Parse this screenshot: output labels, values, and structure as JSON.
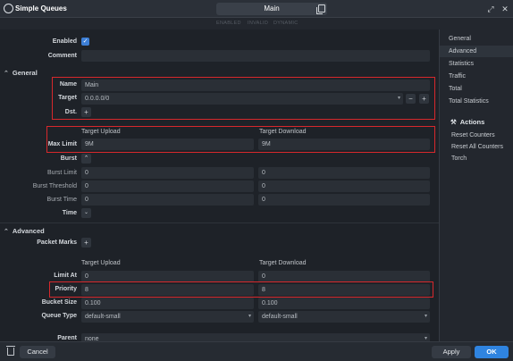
{
  "window": {
    "title": "Simple Queues",
    "name_value": "Main",
    "states": [
      "ENABLED",
      "INVALID",
      "DYNAMIC"
    ]
  },
  "form": {
    "enabled_label": "Enabled",
    "comment_label": "Comment",
    "comment_value": "",
    "general": {
      "section_label": "General",
      "name_label": "Name",
      "name_value": "Main",
      "target_label": "Target",
      "target_value": "0.0.0.0/0",
      "dst_label": "Dst.",
      "col_upload": "Target Upload",
      "col_download": "Target Download",
      "max_limit_label": "Max Limit",
      "max_limit_upload": "9M",
      "max_limit_download": "9M",
      "burst_label": "Burst",
      "burst_limit_label": "Burst Limit",
      "burst_limit_upload": "0",
      "burst_limit_download": "0",
      "burst_threshold_label": "Burst Threshold",
      "burst_threshold_upload": "0",
      "burst_threshold_download": "0",
      "burst_time_label": "Burst Time",
      "burst_time_upload": "0",
      "burst_time_download": "0",
      "time_label": "Time"
    },
    "advanced": {
      "section_label": "Advanced",
      "packet_marks_label": "Packet Marks",
      "col_upload": "Target Upload",
      "col_download": "Target Download",
      "limit_at_label": "Limit At",
      "limit_at_upload": "0",
      "limit_at_download": "0",
      "priority_label": "Priority",
      "priority_upload": "8",
      "priority_download": "8",
      "bucket_size_label": "Bucket Size",
      "bucket_size_upload": "0.100",
      "bucket_size_download": "0.100",
      "queue_type_label": "Queue Type",
      "queue_type_upload": "default-small",
      "queue_type_download": "default-small",
      "parent_label": "Parent",
      "parent_value": "none"
    }
  },
  "sidebar": {
    "tabs": [
      "General",
      "Advanced",
      "Statistics",
      "Traffic",
      "Total",
      "Total Statistics"
    ],
    "actions_header": "Actions",
    "actions": [
      "Reset Counters",
      "Reset All Counters",
      "Torch"
    ]
  },
  "footer": {
    "cancel_label": "Cancel",
    "apply_label": "Apply",
    "ok_label": "OK"
  },
  "colors": {
    "highlight": "#d7282c",
    "accent": "#2f84e0"
  }
}
